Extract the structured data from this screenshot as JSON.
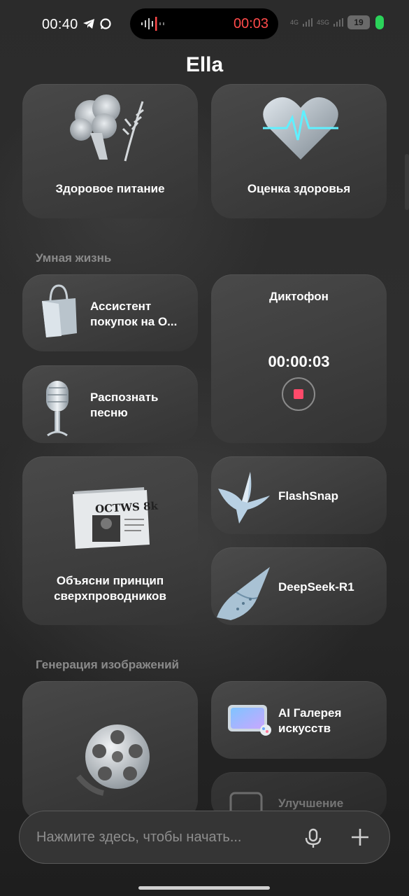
{
  "status": {
    "time": "00:40",
    "recording_time": "00:03",
    "net1": "4G",
    "net2": "4SG",
    "battery": "19",
    "icons": [
      "telegram-icon",
      "chat-bubble-icon",
      "voice-wave-icon"
    ]
  },
  "app": {
    "title": "Ella"
  },
  "top_cards": [
    {
      "label": "Здоровое питание",
      "icon": "broccoli-icon"
    },
    {
      "label": "Оценка здоровья",
      "icon": "heart-pulse-icon"
    }
  ],
  "sections": {
    "smart_life": "Умная жизнь",
    "image_gen": "Генерация изображений"
  },
  "cards": {
    "shopping": {
      "label": "Ассистент покупок на О...",
      "line1": "Ассистент",
      "line2": "покупок на О...",
      "icon": "shopping-bag-icon"
    },
    "dictaphone": {
      "label": "Диктофон",
      "timer": "00:00:03",
      "icon": "stop-record-icon"
    },
    "song": {
      "line1": "Распознать",
      "line2": "песню",
      "icon": "microphone-icon"
    },
    "explain": {
      "line1": "Объясни принцип",
      "line2": "сверхпроводников",
      "newspaper": "OCTWS 8k",
      "icon": "newspaper-icon"
    },
    "flashsnap": {
      "label": "FlashSnap",
      "icon": "bird-icon"
    },
    "deepseek": {
      "label": "DeepSeek-R1",
      "icon": "whale-icon"
    },
    "film": {
      "icon": "film-reel-icon"
    },
    "gallery": {
      "line1": "AI Галерея",
      "line2": "искусств",
      "icon": "gallery-icon"
    },
    "enhance": {
      "label": "Улучшение",
      "icon": "enhance-icon"
    }
  },
  "input": {
    "placeholder": "Нажмите здесь, чтобы начать..."
  },
  "colors": {
    "accent_red": "#ff4a4a",
    "battery_green": "#2bd35a"
  }
}
